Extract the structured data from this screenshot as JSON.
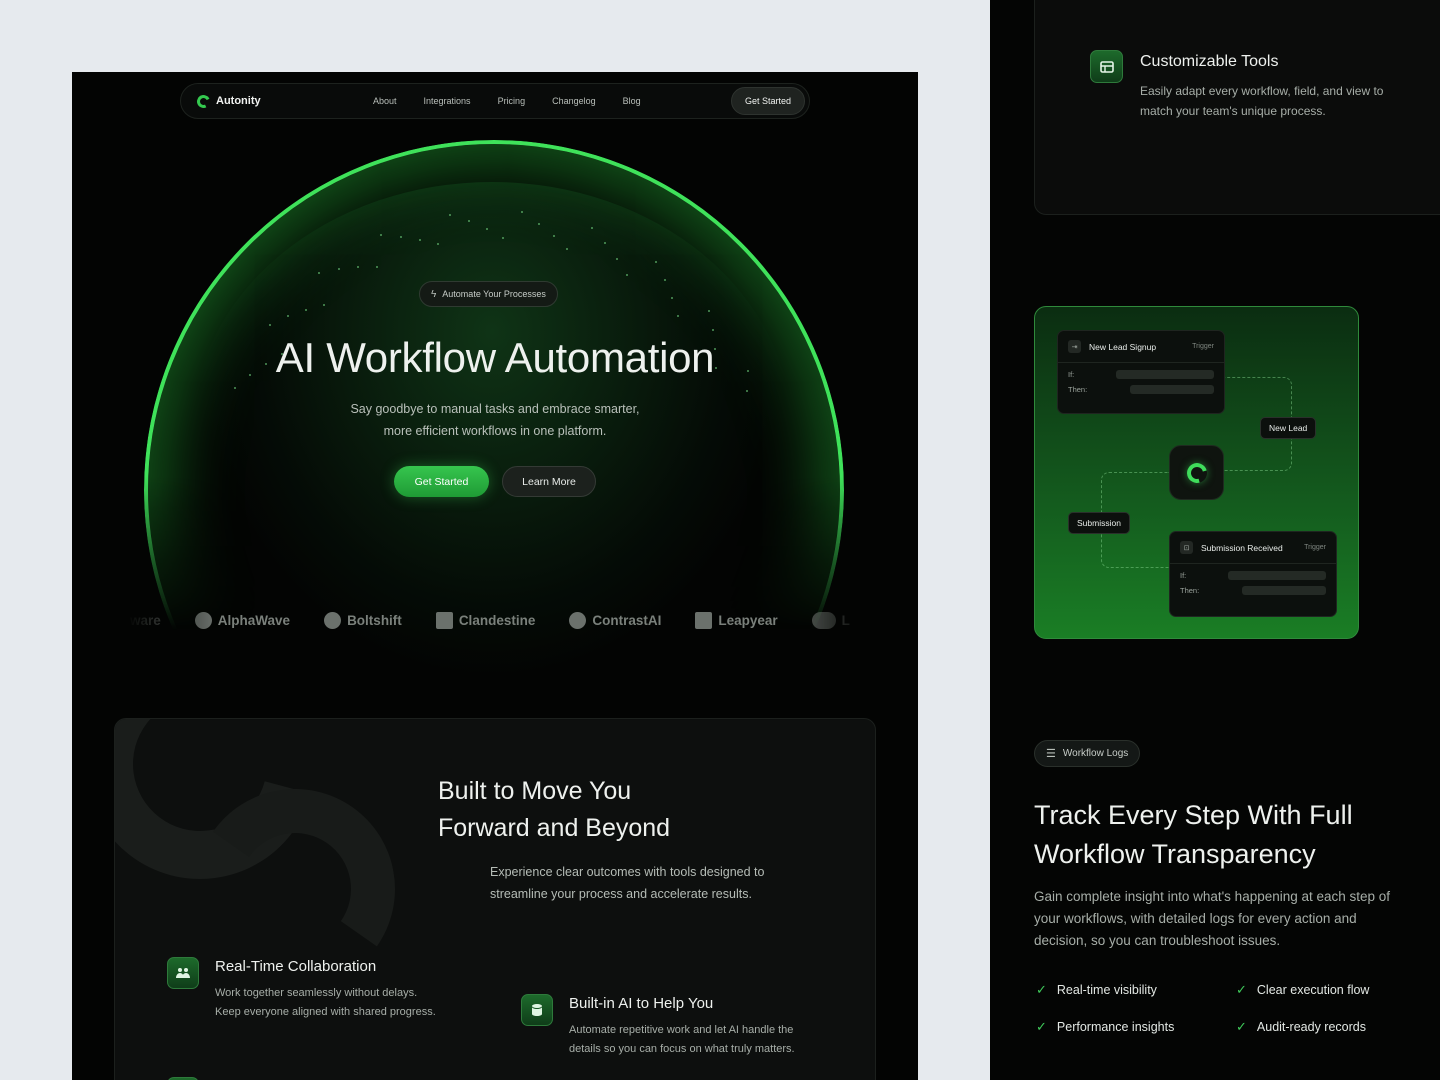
{
  "nav": {
    "brand": "Autonity",
    "links": [
      "About",
      "Integrations",
      "Pricing",
      "Changelog",
      "Blog"
    ],
    "cta": "Get Started"
  },
  "hero": {
    "badge": "Automate Your Processes",
    "title": "AI Workflow Automation",
    "subtitle_line1": "Say goodbye to manual tasks and embrace smarter,",
    "subtitle_line2": "more efficient workflows in one platform.",
    "primary_cta": "Get Started",
    "secondary_cta": "Learn More"
  },
  "partner_logos": [
    "AlphaWave",
    "Boltshift",
    "Clandestine",
    "ContrastAI",
    "Leapyear"
  ],
  "features_section": {
    "title_line1": "Built to Move You",
    "title_line2": "Forward and Beyond",
    "subtitle_line1": "Experience clear outcomes with tools designed to",
    "subtitle_line2": "streamline your process and accelerate results.",
    "features": [
      {
        "title": "Real-Time Collaboration",
        "desc_line1": "Work together seamlessly without delays.",
        "desc_line2": "Keep everyone aligned with shared progress.",
        "icon": "users-icon"
      },
      {
        "title": "Built-in AI to Help You",
        "desc_line1": "Automate repetitive work and let AI handle the",
        "desc_line2": "details so you can focus on what truly matters.",
        "icon": "database-icon"
      }
    ]
  },
  "customizable_tools": {
    "title": "Customizable Tools",
    "desc_line1": "Easily adapt every workflow, field, and view to",
    "desc_line2": "match your team's unique process.",
    "icon": "table-icon"
  },
  "flow_diagram": {
    "node1": {
      "title": "New Lead Signup",
      "tag": "Trigger",
      "if_label": "If:",
      "then_label": "Then:"
    },
    "node2": {
      "title": "Submission Received",
      "tag": "Trigger",
      "if_label": "If:",
      "then_label": "Then:"
    },
    "label_new_lead": "New Lead",
    "label_submission": "Submission"
  },
  "workflow_logs": {
    "badge": "Workflow Logs",
    "title_line1": "Track Every Step With Full",
    "title_line2": "Workflow Transparency",
    "desc_line1": "Gain complete insight into what's happening at each step of",
    "desc_line2": "your workflows, with detailed logs for every action and",
    "desc_line3": "decision, so you can troubleshoot issues.",
    "checks": [
      "Real-time visibility",
      "Clear execution flow",
      "Performance insights",
      "Audit-ready records"
    ]
  },
  "colors": {
    "accent": "#36c54e",
    "background": "#030403",
    "canvas": "#e6eaee"
  }
}
